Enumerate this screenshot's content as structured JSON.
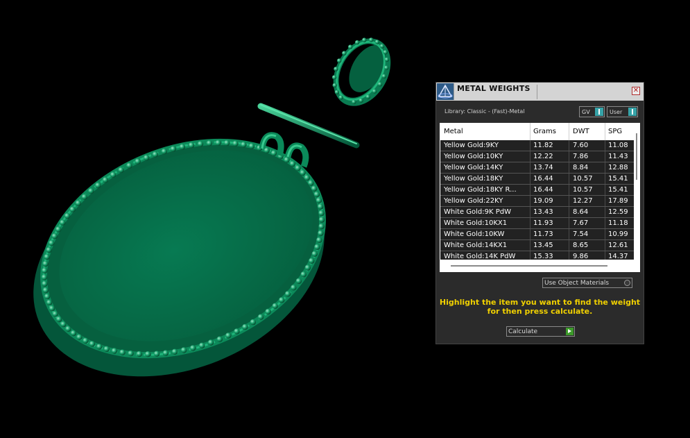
{
  "window": {
    "title": "METAL WEIGHTS",
    "close_glyph": "✕",
    "library_label": "Library: Classic - (Fast)-Metal"
  },
  "toggles": {
    "gv": "GV",
    "user": "User"
  },
  "table": {
    "headers": [
      "Metal",
      "Grams",
      "DWT",
      "SPG"
    ],
    "rows": [
      [
        "Yellow Gold:9KY",
        "11.82",
        "7.60",
        "11.08"
      ],
      [
        "Yellow Gold:10KY",
        "12.22",
        "7.86",
        "11.43"
      ],
      [
        "Yellow Gold:14KY",
        "13.74",
        "8.84",
        "12.88"
      ],
      [
        "Yellow Gold:18KY",
        "16.44",
        "10.57",
        "15.41"
      ],
      [
        "Yellow Gold:18KY R...",
        "16.44",
        "10.57",
        "15.41"
      ],
      [
        "Yellow Gold:22KY",
        "19.09",
        "12.27",
        "17.89"
      ],
      [
        "White Gold:9K PdW",
        "13.43",
        "8.64",
        "12.59"
      ],
      [
        "White Gold:10KX1",
        "11.93",
        "7.67",
        "11.18"
      ],
      [
        "White Gold:10KW",
        "11.73",
        "7.54",
        "10.99"
      ],
      [
        "White Gold:14KX1",
        "13.45",
        "8.65",
        "12.61"
      ],
      [
        "White Gold:14K PdW",
        "15.33",
        "9.86",
        "14.37"
      ]
    ]
  },
  "use_object_materials": "Use Object Materials",
  "hint": [
    "Highlight the item you want to find the weight",
    "for then press calculate."
  ],
  "calculate_label": "Calculate",
  "colors": {
    "model_green": "#0a7a50",
    "hint_yellow": "#f0d000",
    "accent_teal": "#36a3a8"
  },
  "icons": {
    "app": "pyramid-logo-icon",
    "close": "close-icon",
    "calculate": "play-arrow-icon"
  }
}
